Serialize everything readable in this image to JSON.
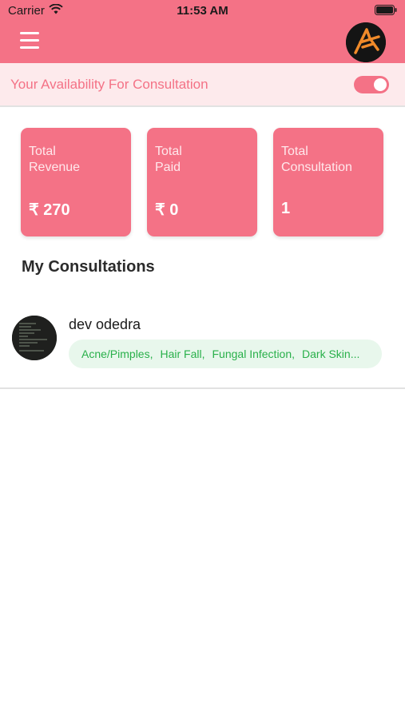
{
  "status_bar": {
    "carrier": "Carrier",
    "time": "11:53 AM"
  },
  "header": {
    "menu_icon": "hamburger-menu-icon",
    "logo_icon": "star-logo-icon"
  },
  "availability": {
    "label": "Your Availability For Consultation",
    "enabled": true
  },
  "stats": [
    {
      "title": "Total\nRevenue",
      "value": "₹ 270"
    },
    {
      "title": "Total\nPaid",
      "value": "₹ 0"
    },
    {
      "title": "Total\nConsultation",
      "value": "1"
    }
  ],
  "section_title": "My Consultations",
  "consultations": [
    {
      "name": "dev odedra",
      "tags": [
        "Acne/Pimples,",
        "Hair Fall,",
        "Fungal Infection,",
        "Dark Skin..."
      ]
    }
  ],
  "colors": {
    "primary": "#f47286",
    "availability_bg": "#fdeaec",
    "tag_bg": "#e8f7ec",
    "tag_text": "#29b04a"
  }
}
